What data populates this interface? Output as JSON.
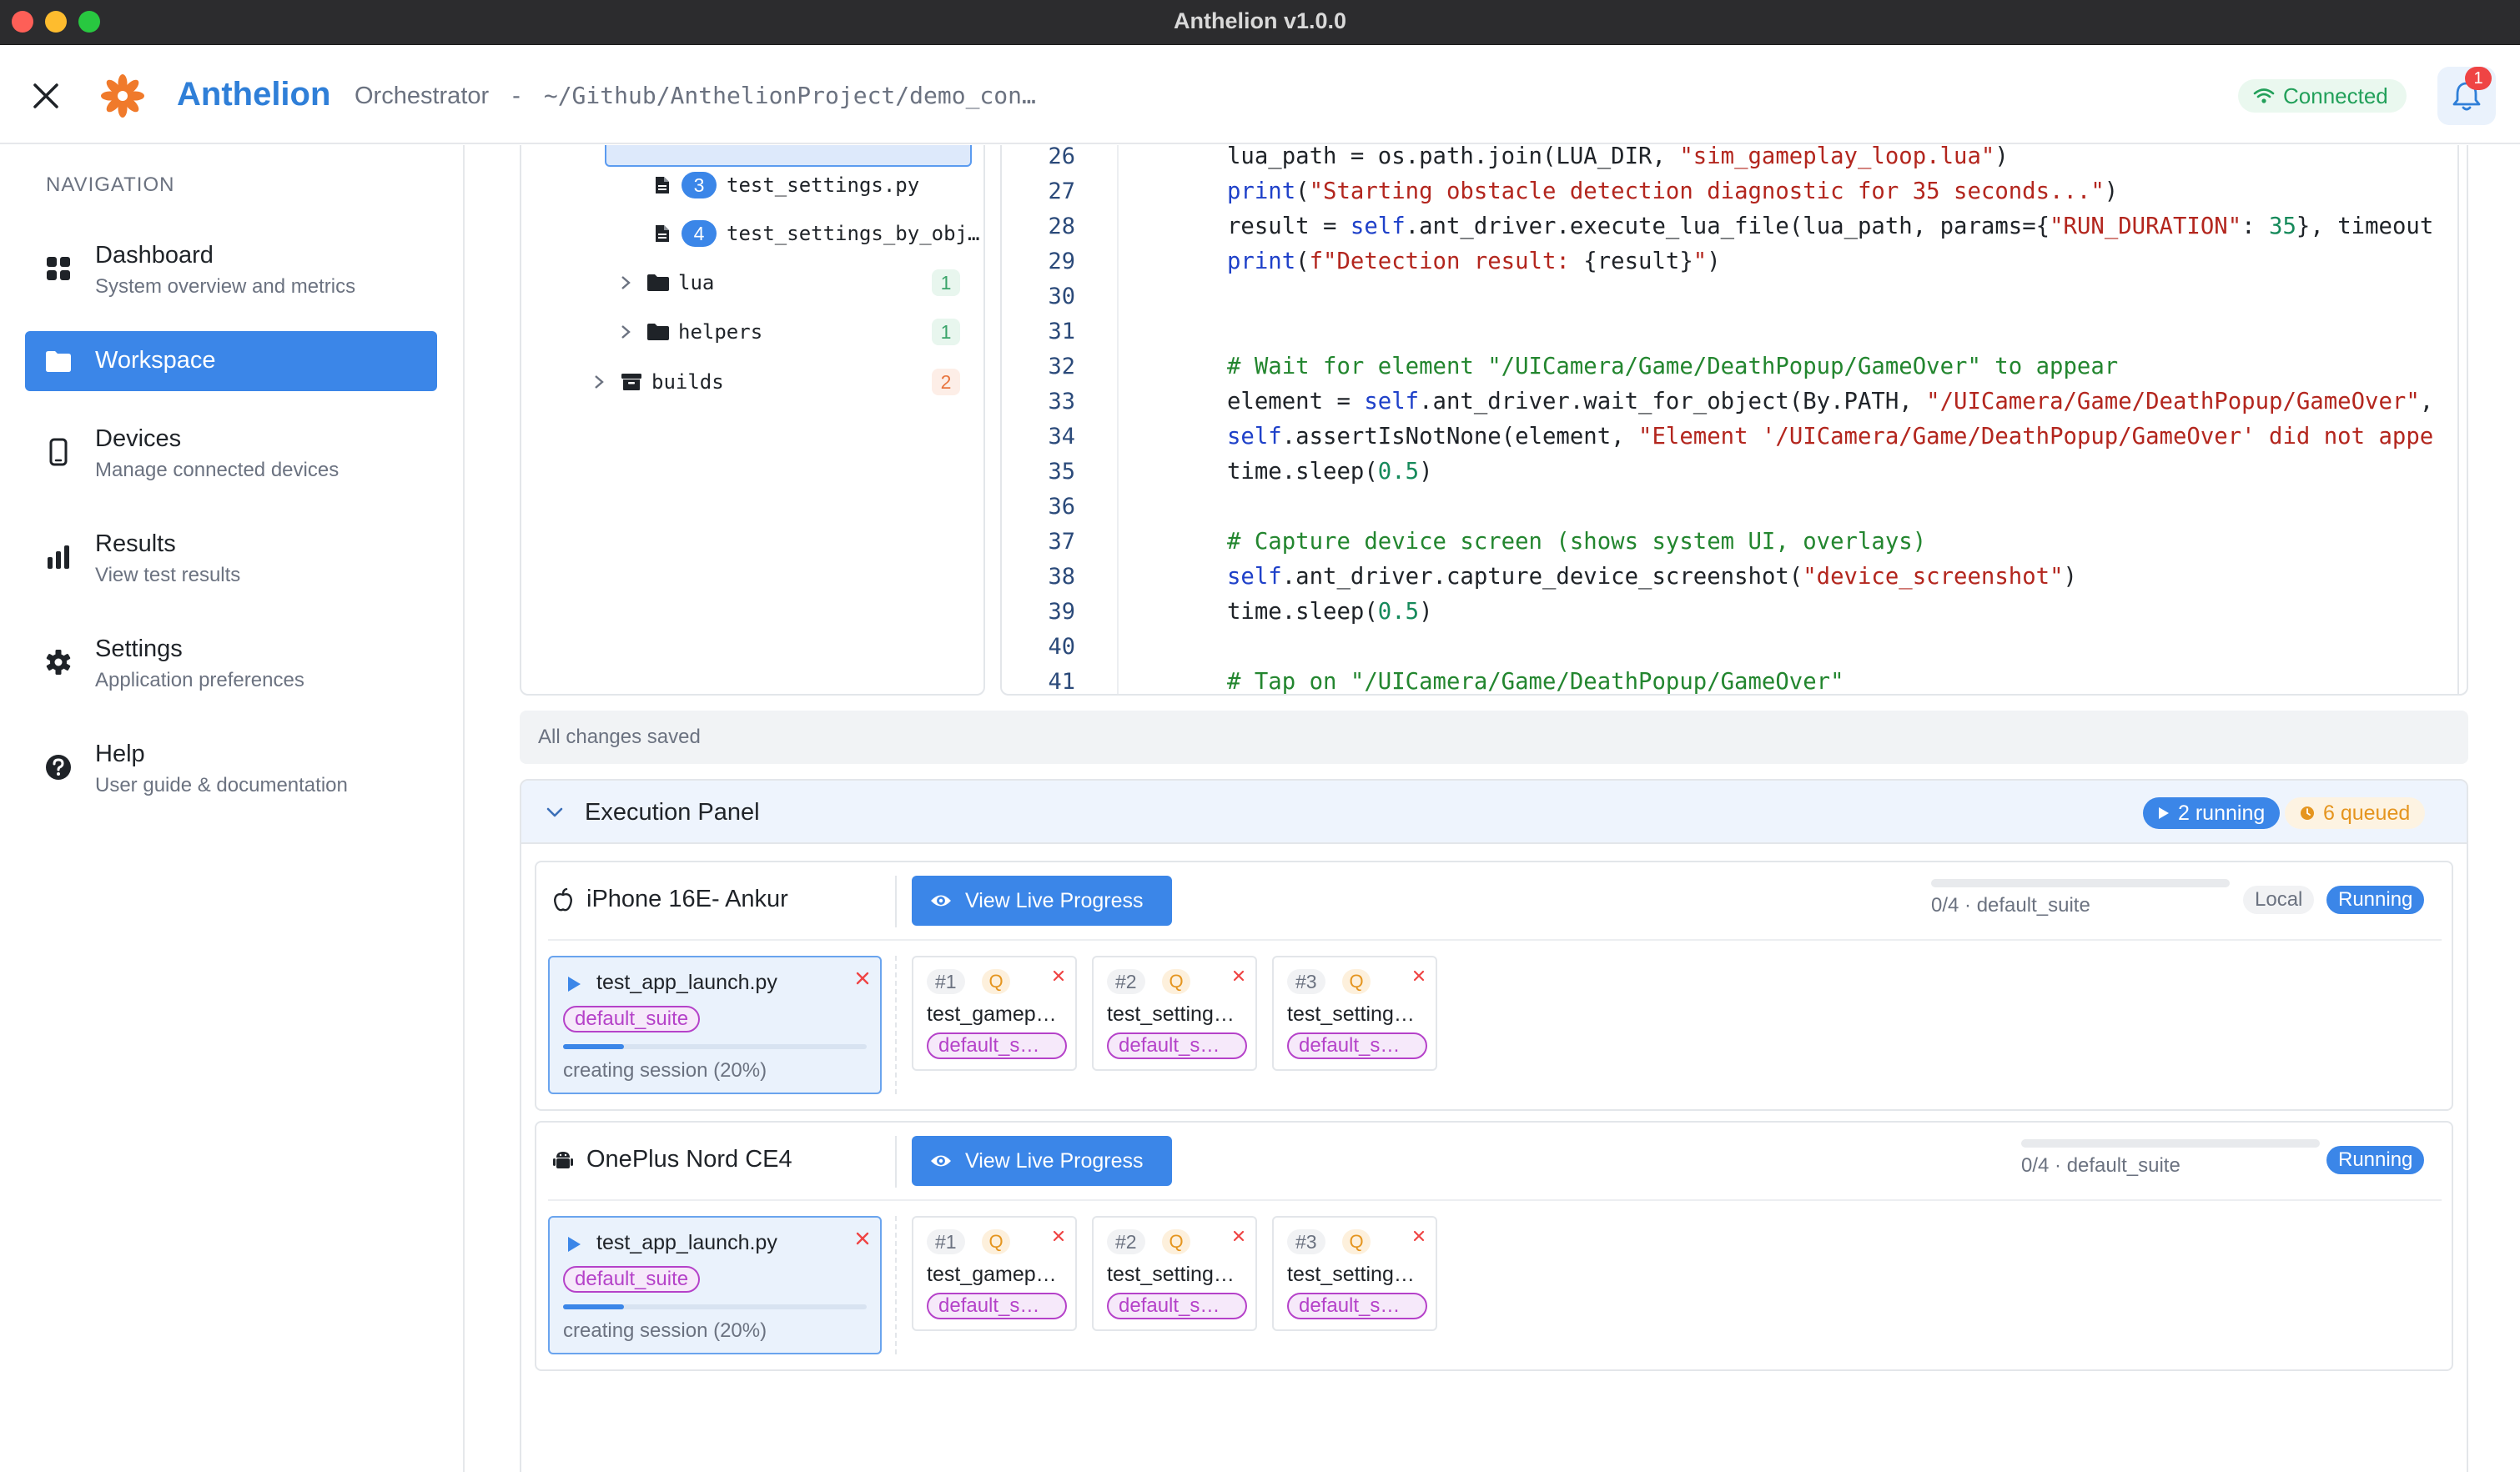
{
  "window": {
    "title": "Anthelion v1.0.0"
  },
  "header": {
    "brand": "Anthelion",
    "section": "Orchestrator",
    "separator": "-",
    "path": "~/Github/AnthelionProject/demo_con…",
    "connection_status": "Connected",
    "notification_count": "1"
  },
  "sidebar": {
    "heading": "NAVIGATION",
    "items": [
      {
        "label": "Dashboard",
        "sub": "System overview and metrics",
        "icon": "grid-icon"
      },
      {
        "label": "Workspace",
        "sub": "",
        "icon": "folder-icon",
        "active": true
      },
      {
        "label": "Devices",
        "sub": "Manage connected devices",
        "icon": "phone-icon"
      },
      {
        "label": "Results",
        "sub": "View test results",
        "icon": "bar-chart-icon"
      },
      {
        "label": "Settings",
        "sub": "Application preferences",
        "icon": "gear-icon"
      },
      {
        "label": "Help",
        "sub": "User guide & documentation",
        "icon": "help-icon"
      }
    ]
  },
  "file_tree": {
    "files": [
      {
        "num": "3",
        "name": "test_settings.py"
      },
      {
        "num": "4",
        "name": "test_settings_by_obj…"
      }
    ],
    "folders": [
      {
        "name": "lua",
        "count": "1"
      },
      {
        "name": "helpers",
        "count": "1"
      },
      {
        "name": "builds",
        "count": "2"
      }
    ]
  },
  "code": {
    "line_numbers": [
      "26",
      "27",
      "28",
      "29",
      "30",
      "31",
      "32",
      "33",
      "34",
      "35",
      "36",
      "37",
      "38",
      "39",
      "40",
      "41"
    ]
  },
  "status_bar": {
    "text": "All changes saved"
  },
  "execution_panel": {
    "title": "Execution Panel",
    "running_label": "2 running",
    "queued_label": "6 queued",
    "devices": [
      {
        "name": "iPhone 16E- Ankur",
        "platform_icon": "apple-icon",
        "live_button": "View Live Progress",
        "suite_progress": "0/4 · default_suite",
        "progress_fraction": 0,
        "mode_tag": "Local",
        "status_tag": "Running",
        "active_test": {
          "name": "test_app_launch.py",
          "suite": "default_suite",
          "status": "creating session (20%)",
          "progress": 0.2
        },
        "queued": [
          {
            "index": "#1",
            "q": "Q",
            "name": "test_gamep…",
            "suite": "default_s…"
          },
          {
            "index": "#2",
            "q": "Q",
            "name": "test_setting…",
            "suite": "default_s…"
          },
          {
            "index": "#3",
            "q": "Q",
            "name": "test_setting…",
            "suite": "default_s…"
          }
        ]
      },
      {
        "name": "OnePlus Nord CE4",
        "platform_icon": "android-icon",
        "live_button": "View Live Progress",
        "suite_progress": "0/4 · default_suite",
        "progress_fraction": 0,
        "status_tag": "Running",
        "active_test": {
          "name": "test_app_launch.py",
          "suite": "default_suite",
          "status": "creating session (20%)",
          "progress": 0.2
        },
        "queued": [
          {
            "index": "#1",
            "q": "Q",
            "name": "test_gamep…",
            "suite": "default_s…"
          },
          {
            "index": "#2",
            "q": "Q",
            "name": "test_setting…",
            "suite": "default_s…"
          },
          {
            "index": "#3",
            "q": "Q",
            "name": "test_setting…",
            "suite": "default_s…"
          }
        ]
      }
    ]
  },
  "colors": {
    "accent": "#3b86e8",
    "brand": "#2f7fd8",
    "connected": "#22a05a",
    "queued": "#e5951f",
    "suite_tag": "#b542c9",
    "danger": "#ef4444"
  }
}
